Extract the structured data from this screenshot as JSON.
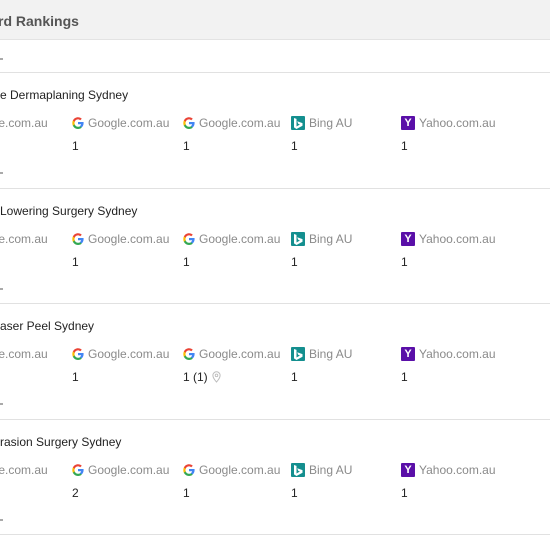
{
  "header": {
    "title": "rd Rankings"
  },
  "engines": {
    "e0": "gle.com.au",
    "e1": "Google.com.au",
    "e2": "Google.com.au",
    "e3": "Bing AU",
    "e4": "Yahoo.com.au"
  },
  "keywords": [
    {
      "name": "e Dermaplaning Sydney",
      "ranks": [
        "1",
        "1",
        "1",
        "1"
      ]
    },
    {
      "name": "Lowering Surgery Sydney",
      "ranks": [
        "1",
        "1",
        "1",
        "1"
      ]
    },
    {
      "name": "aser Peel Sydney",
      "ranks": [
        "1",
        "1 (1)",
        "1",
        "1"
      ]
    },
    {
      "name": "rasion Surgery Sydney",
      "ranks": [
        "2",
        "1",
        "1",
        "1"
      ]
    }
  ],
  "icons": {
    "google": "google-icon",
    "bing": "bing-icon",
    "yahoo": "yahoo-icon",
    "pin": "map-pin-icon"
  },
  "colors": {
    "bing": "#148f8f",
    "yahoo": "#5a0fa8"
  }
}
